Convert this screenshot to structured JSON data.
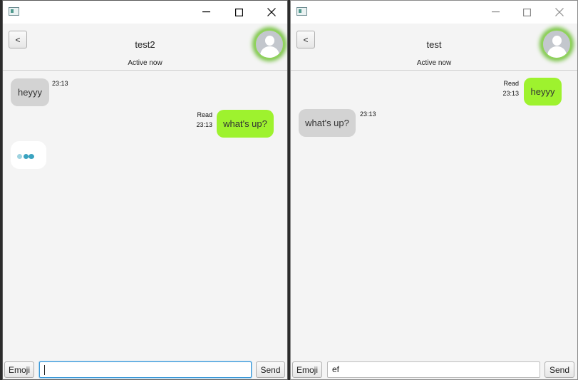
{
  "left_window": {
    "contact_name": "test2",
    "status": "Active now",
    "back_label": "<",
    "messages": [
      {
        "text": "heyyy",
        "time": "23:13"
      },
      {
        "text": "what's up?",
        "read": "Read",
        "time": "23:13"
      }
    ],
    "emoji_label": "Emoji",
    "send_label": "Send",
    "input_value": ""
  },
  "right_window": {
    "contact_name": "test",
    "status": "Active now",
    "back_label": "<",
    "messages": [
      {
        "text": "heyyy",
        "read": "Read",
        "time": "23:13"
      },
      {
        "text": "what's up?",
        "time": "23:13"
      }
    ],
    "emoji_label": "Emoji",
    "send_label": "Send",
    "input_value": "ef"
  },
  "colors": {
    "sent_bubble": "#9ef22e",
    "received_bubble": "#d3d3d3",
    "online_glow": "#7cc44a",
    "typing_dots": "#3aa3c0"
  },
  "icons": [
    "app-icon",
    "minimize-icon",
    "maximize-icon",
    "close-icon",
    "user-avatar-icon",
    "typing-indicator"
  ]
}
